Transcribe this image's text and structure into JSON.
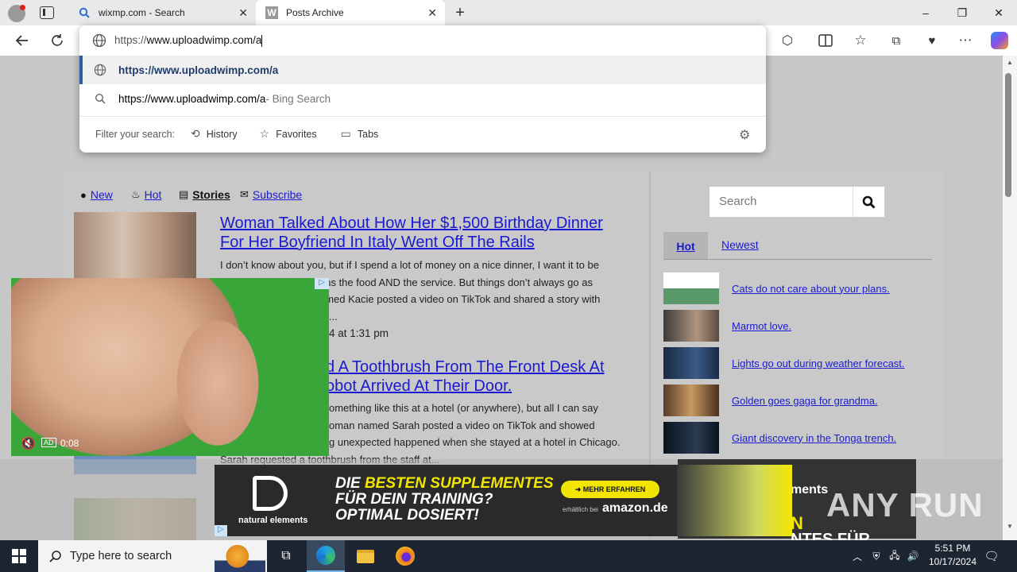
{
  "browser": {
    "tabs": [
      {
        "title": "wixmp.com - Search",
        "icon": "search-icon"
      },
      {
        "title": "Posts Archive",
        "icon": "w-logo-icon"
      }
    ],
    "new_tab_label": "+",
    "window_controls": {
      "minimize": "–",
      "maximize": "❐",
      "close": "✕"
    },
    "address_value": "https://www.uploadwimp.com/a",
    "address_scheme": "https://",
    "address_rest": "www.uploadwimp.com/a",
    "suggestions": [
      {
        "text": "https://www.uploadwimp.com/a",
        "suffix": "",
        "icon": "globe-icon"
      },
      {
        "text": "https://www.uploadwimp.com/a",
        "suffix": " - Bing Search",
        "icon": "search-icon"
      }
    ],
    "filter_label": "Filter your search:",
    "filters": [
      "History",
      "Favorites",
      "Tabs"
    ]
  },
  "site": {
    "nav": [
      {
        "label": "New",
        "icon": "clock-icon"
      },
      {
        "label": "Hot",
        "icon": "flame-icon"
      },
      {
        "label": "Stories",
        "icon": "list-icon"
      },
      {
        "label": "Subscribe",
        "icon": "mail-icon"
      }
    ],
    "posts": [
      {
        "headline_1": "Woman Talked About How Her $1,500 Birthday Dinner",
        "headline_2": "For Her Boyfriend In Italy Went Off The Rails",
        "excerpt": [
          "I don’t know about you, but if I spend a lot of money on a nice dinner, I want it to be",
          "ans the food AND the service. But things don’t always go as",
          "amed Kacie posted a video on TikTok and shared a story with",
          "..."
        ],
        "date": "4 at 1:31 pm"
      },
      {
        "headline_1": "d A Toothbrush From The Front Desk At",
        "headline_2": "obot Arrived At Their Door.",
        "excerpt": [
          "omething like this at a hotel (or anywhere), but all I can say",
          "oman named Sarah posted a video on TikTok and showed",
          "g unexpected happened when she stayed at a hotel in Chicago.",
          "Sarah requested a toothbrush from the staff at..."
        ]
      }
    ],
    "sidebar": {
      "search_placeholder": "Search",
      "tabs": [
        "Hot",
        "Newest"
      ],
      "items": [
        "Cats do not care about your plans.",
        "Marmot love.",
        "Lights go out during weather forecast.",
        "Golden goes gaga for grandma.",
        "Giant discovery in the Tonga trench."
      ]
    }
  },
  "ads": {
    "video_time": "0:08",
    "video_ad_badge": "AD",
    "banner_brand": "natural elements",
    "banner_line1a": "DIE ",
    "banner_line1b": "BESTEN SUPPLEMENTES",
    "banner_line2": "FÜR DEIN TRAINING?",
    "banner_line3": "OPTIMAL DOSIERT!",
    "banner_cta": "➜ MEHR ERFAHREN",
    "banner_sub": "erhältlich bei",
    "banner_amazon": "amazon.de",
    "banner2_text_1": "ments",
    "banner2_text_2": "N",
    "banner2_text_3": "NTES FÜR"
  },
  "watermark": "ANY RUN",
  "taskbar": {
    "search_placeholder": "Type here to search",
    "time": "5:51 PM",
    "date": "10/17/2024"
  },
  "colors": {
    "link": "#1a1ad0",
    "edge_accent": "#2c5d9e",
    "banner_yellow": "#f2e600",
    "taskbar": "#1c2531"
  }
}
